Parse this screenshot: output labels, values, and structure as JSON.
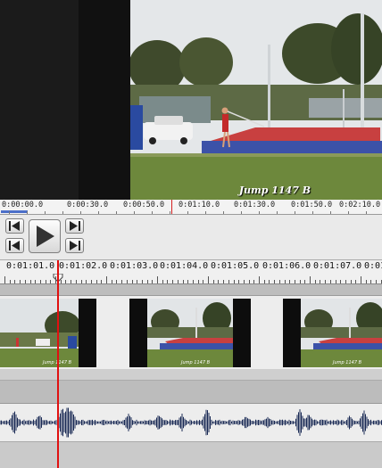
{
  "viewer": {
    "caption": "Jump 1147 B",
    "colors": {
      "sky": "#e6eaec",
      "grass": "#6f8a3d",
      "mat": "#c83a3a",
      "mat_base": "#3a4ea8"
    }
  },
  "overview_ruler": {
    "labels": [
      "0:00:00.0",
      "0:00:30.0",
      "0:00:50.0",
      "0:01:10.0",
      "0:01:30.0",
      "0:01:50.0",
      "0:02:10.0"
    ]
  },
  "transport": {
    "buttons": [
      {
        "name": "step-back-button",
        "icon": "step-back-icon"
      },
      {
        "name": "step-forward-button",
        "icon": "step-forward-icon"
      },
      {
        "name": "play-button",
        "icon": "play-icon"
      },
      {
        "name": "go-to-start-button",
        "icon": "skip-to-start-icon"
      },
      {
        "name": "go-to-end-button",
        "icon": "skip-to-end-icon"
      }
    ]
  },
  "timeline_ruler": {
    "labels": [
      "0:01:01.0",
      "0:01:02.0",
      "0:01:03.0",
      "0:01:04.0",
      "0:01:05.0",
      "0:01:06.0",
      "0:01:07.0",
      "0:01:0"
    ]
  },
  "video_track": {
    "clip_caption": "Jump 1147 B"
  },
  "colors": {
    "playhead": "#e01010",
    "waveform": "#1a2a55"
  }
}
